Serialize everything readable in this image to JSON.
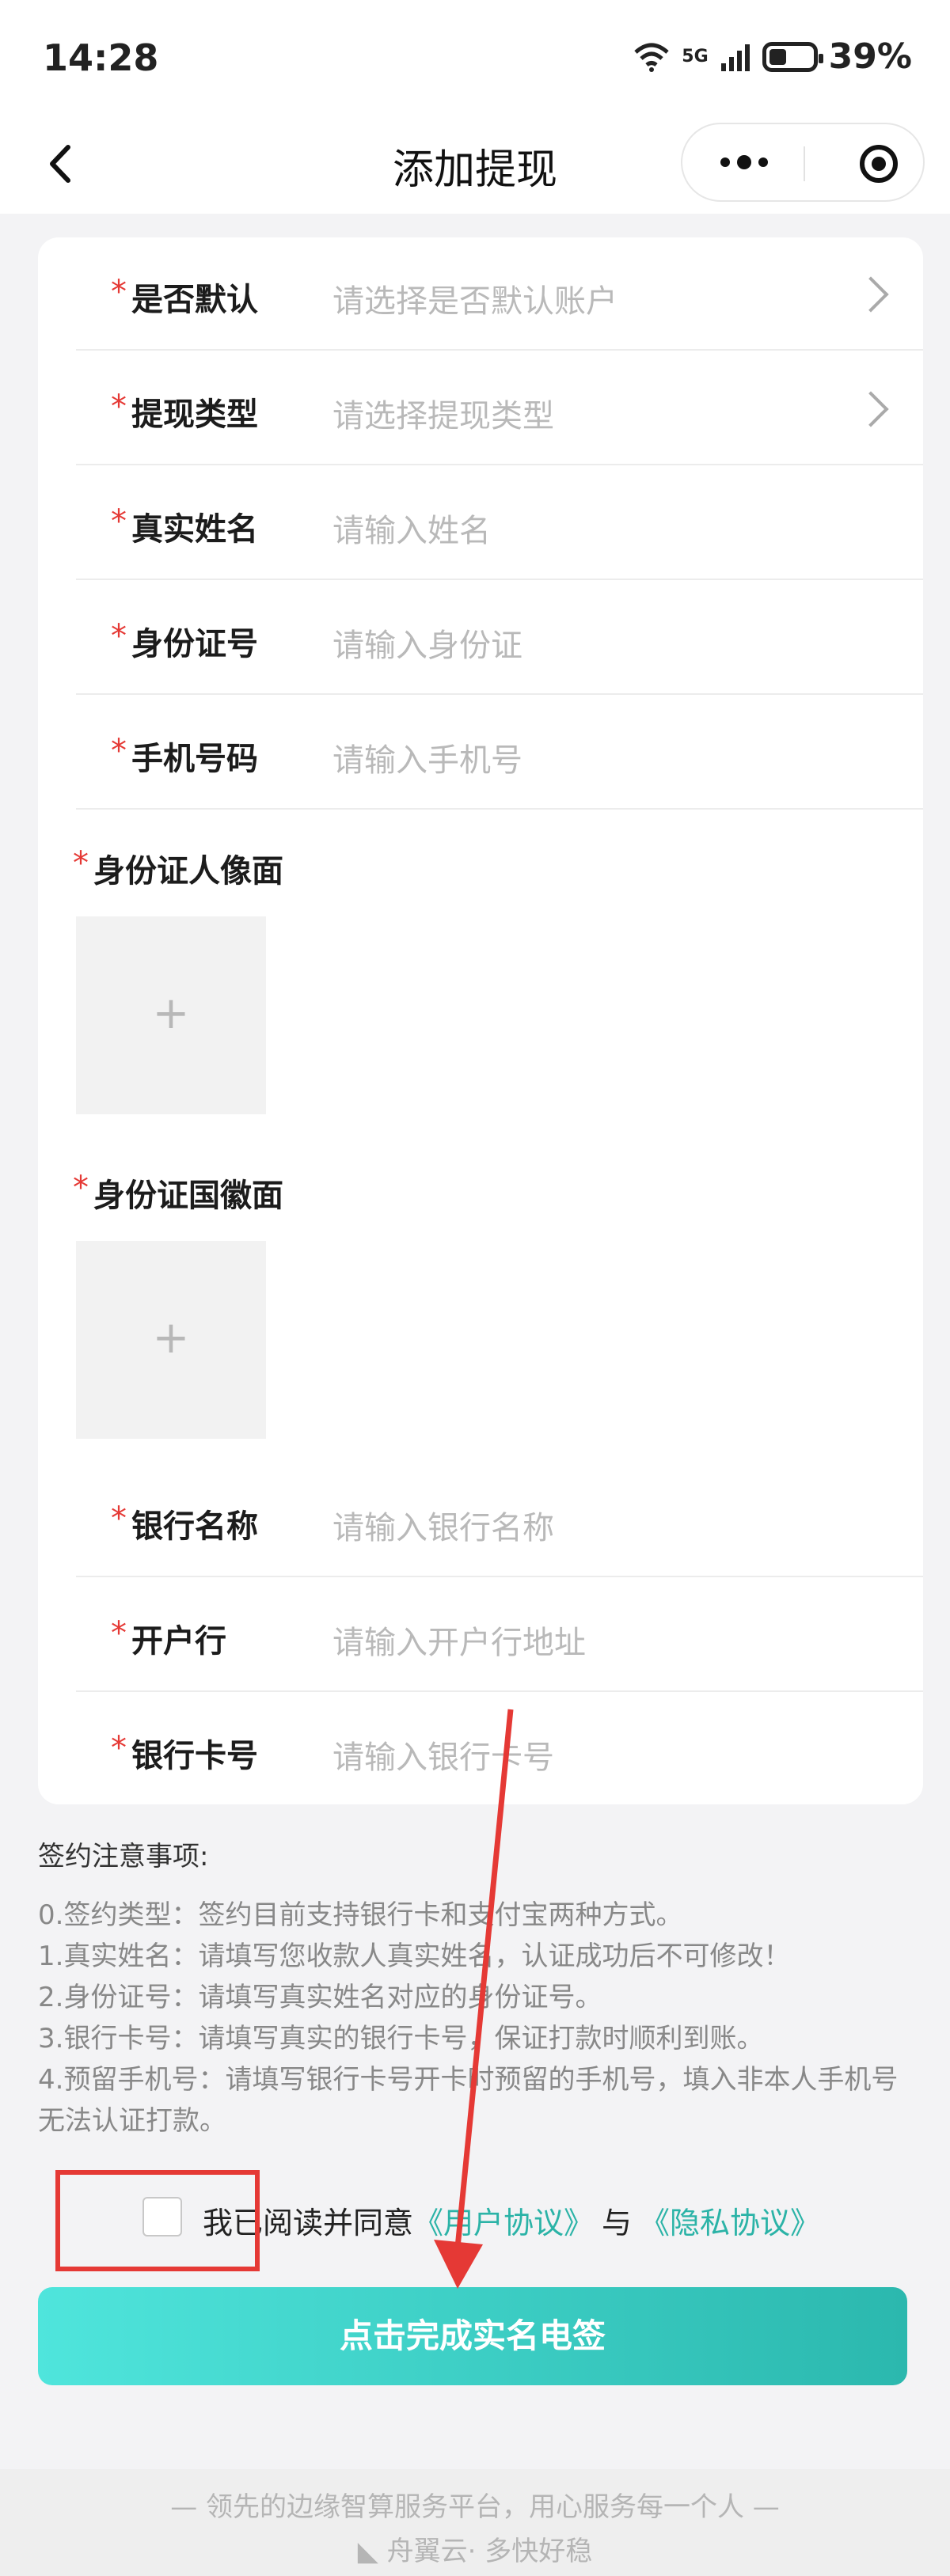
{
  "status_bar": {
    "time": "14:28",
    "network": "5G",
    "battery": "39%"
  },
  "nav": {
    "title": "添加提现"
  },
  "form": {
    "rows": [
      {
        "label": "是否默认",
        "placeholder": "请选择是否默认账户"
      },
      {
        "label": "提现类型",
        "placeholder": "请选择提现类型"
      },
      {
        "label": "真实姓名",
        "placeholder": "请输入姓名"
      },
      {
        "label": "身份证号",
        "placeholder": "请输入身份证"
      },
      {
        "label": "手机号码",
        "placeholder": "请输入手机号"
      },
      {
        "label": "身份证人像面"
      },
      {
        "label": "身份证国徽面"
      },
      {
        "label": "银行名称",
        "placeholder": "请输入银行名称"
      },
      {
        "label": "开户行",
        "placeholder": "请输入开户行地址"
      },
      {
        "label": "银行卡号",
        "placeholder": "请输入银行卡号"
      }
    ],
    "required_mark": "*",
    "upload_plus": "+"
  },
  "notes": {
    "title": "签约注意事项:",
    "items": [
      "0.签约类型：签约目前支持银行卡和支付宝两种方式。",
      "1.真实姓名：请填写您收款人真实姓名，认证成功后不可修改！",
      "2.身份证号：请填写真实姓名对应的身份证号。",
      "3.银行卡号：请填写真实的银行卡号，保证打款时顺利到账。",
      "4.预留手机号：请填写银行卡号开卡时预留的手机号，填入非本人手机号无法认证打款。"
    ]
  },
  "agreement": {
    "prefix": "我已阅读并同意",
    "user_agreement": "《用户协议》",
    "conj": "与",
    "privacy_agreement": "《隐私协议》"
  },
  "submit_label": "点击完成实名电签",
  "footer": {
    "slogan": "— 领先的边缘智算服务平台，用心服务每一个人 —",
    "brand": "舟翼云· 多快好稳"
  },
  "colors": {
    "accent": "#2bb3a7",
    "required": "#e53935",
    "annotation": "#e53935"
  }
}
